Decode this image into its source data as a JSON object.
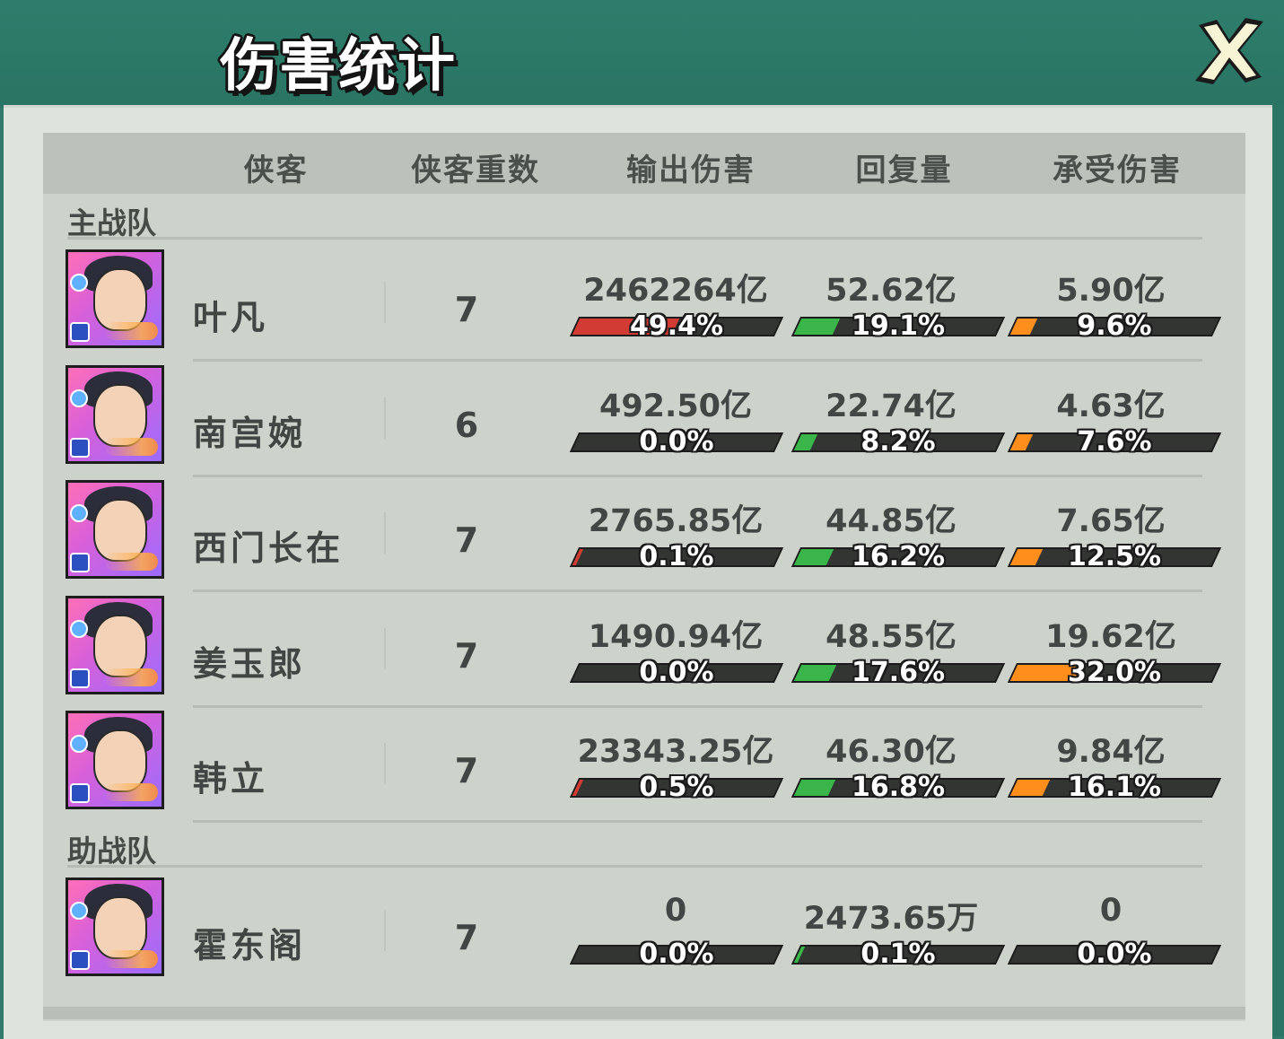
{
  "title": "伤害统计",
  "close_icon": "close-x-icon",
  "headers": [
    "侠客",
    "侠客重数",
    "输出伤害",
    "回复量",
    "承受伤害"
  ],
  "sections": {
    "main": "主战队",
    "support": "助战队"
  },
  "colors": {
    "output_bar": "#d23a34",
    "heal_bar": "#39b54a",
    "taken_bar": "#ff8e1c"
  },
  "rows": [
    {
      "name": "叶凡",
      "count": "7",
      "output": "2462264亿",
      "output_pct": "49.4%",
      "output_frac": 0.494,
      "heal": "52.62亿",
      "heal_pct": "19.1%",
      "heal_frac": 0.191,
      "taken": "5.90亿",
      "taken_pct": "9.6%",
      "taken_frac": 0.096
    },
    {
      "name": "南宫婉",
      "count": "6",
      "output": "492.50亿",
      "output_pct": "0.0%",
      "output_frac": 0.0,
      "heal": "22.74亿",
      "heal_pct": "8.2%",
      "heal_frac": 0.082,
      "taken": "4.63亿",
      "taken_pct": "7.6%",
      "taken_frac": 0.076
    },
    {
      "name": "西门长在",
      "count": "7",
      "output": "2765.85亿",
      "output_pct": "0.1%",
      "output_frac": 0.001,
      "heal": "44.85亿",
      "heal_pct": "16.2%",
      "heal_frac": 0.162,
      "taken": "7.65亿",
      "taken_pct": "12.5%",
      "taken_frac": 0.125
    },
    {
      "name": "姜玉郎",
      "count": "7",
      "output": "1490.94亿",
      "output_pct": "0.0%",
      "output_frac": 0.0,
      "heal": "48.55亿",
      "heal_pct": "17.6%",
      "heal_frac": 0.176,
      "taken": "19.62亿",
      "taken_pct": "32.0%",
      "taken_frac": 0.32
    },
    {
      "name": "韩立",
      "count": "7",
      "output": "23343.25亿",
      "output_pct": "0.5%",
      "output_frac": 0.005,
      "heal": "46.30亿",
      "heal_pct": "16.8%",
      "heal_frac": 0.168,
      "taken": "9.84亿",
      "taken_pct": "16.1%",
      "taken_frac": 0.161
    },
    {
      "name": "霍东阁",
      "count": "7",
      "output": "0",
      "output_pct": "0.0%",
      "output_frac": 0.0,
      "heal": "2473.65万",
      "heal_pct": "0.1%",
      "heal_frac": 0.001,
      "taken": "0",
      "taken_pct": "0.0%",
      "taken_frac": 0.0
    }
  ]
}
